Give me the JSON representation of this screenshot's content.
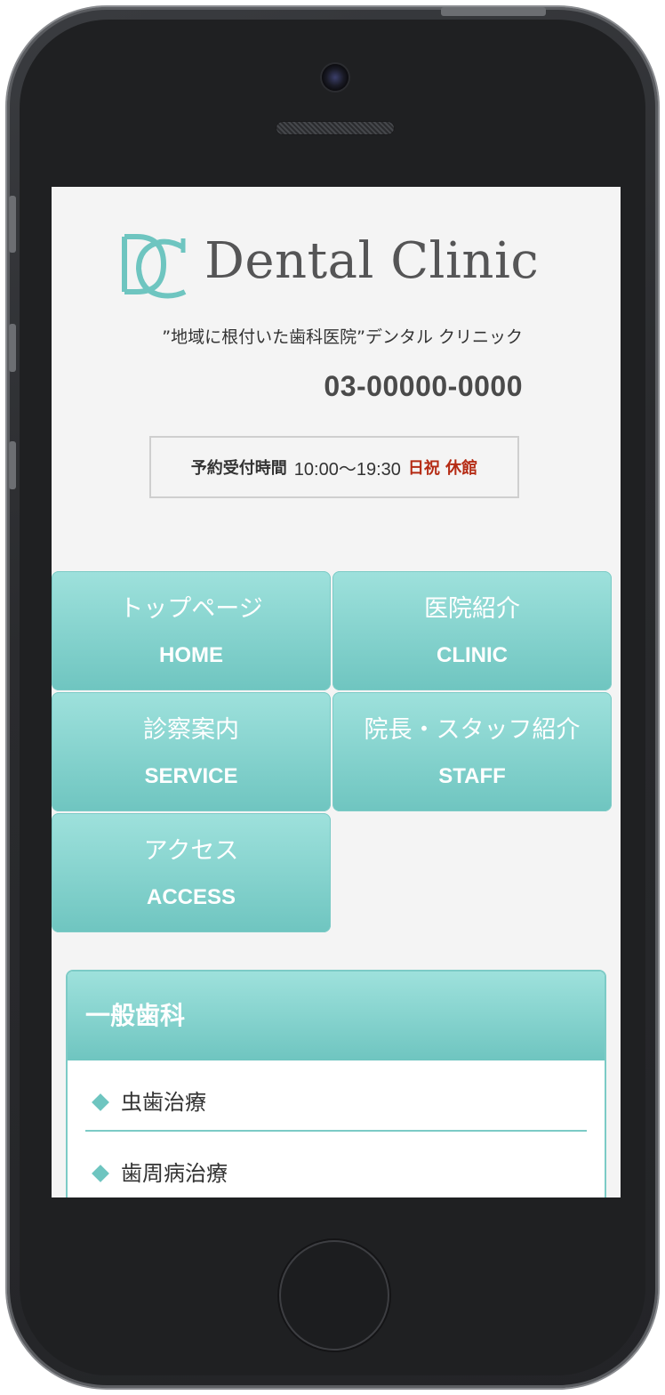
{
  "device": {
    "camera_icon": "front-camera-icon",
    "speaker_icon": "speaker-grille-icon",
    "home_icon": "home-button-icon"
  },
  "header": {
    "logo_mark": "DC",
    "logo_text": "Dental Clinic",
    "tagline": "”地域に根付いた歯科医院”デンタル クリニック",
    "phone": "03-00000-0000",
    "hours": {
      "label": "予約受付時間",
      "time": "10:00〜19:30",
      "closed": "日祝 休館"
    }
  },
  "nav": {
    "items": [
      {
        "jp": "トップページ",
        "en": "HOME"
      },
      {
        "jp": "医院紹介",
        "en": "CLINIC"
      },
      {
        "jp": "診察案内",
        "en": "SERVICE"
      },
      {
        "jp": "院長・スタッフ紹介",
        "en": "STAFF"
      },
      {
        "jp": "アクセス",
        "en": "ACCESS"
      }
    ]
  },
  "services": {
    "title": "一般歯科",
    "items": [
      "虫歯治療",
      "歯周病治療"
    ]
  },
  "colors": {
    "accent": "#84d2cd",
    "accent_dark": "#6fc5c0",
    "closed_text": "#b52b14",
    "screen_bg": "#f4f4f4"
  }
}
